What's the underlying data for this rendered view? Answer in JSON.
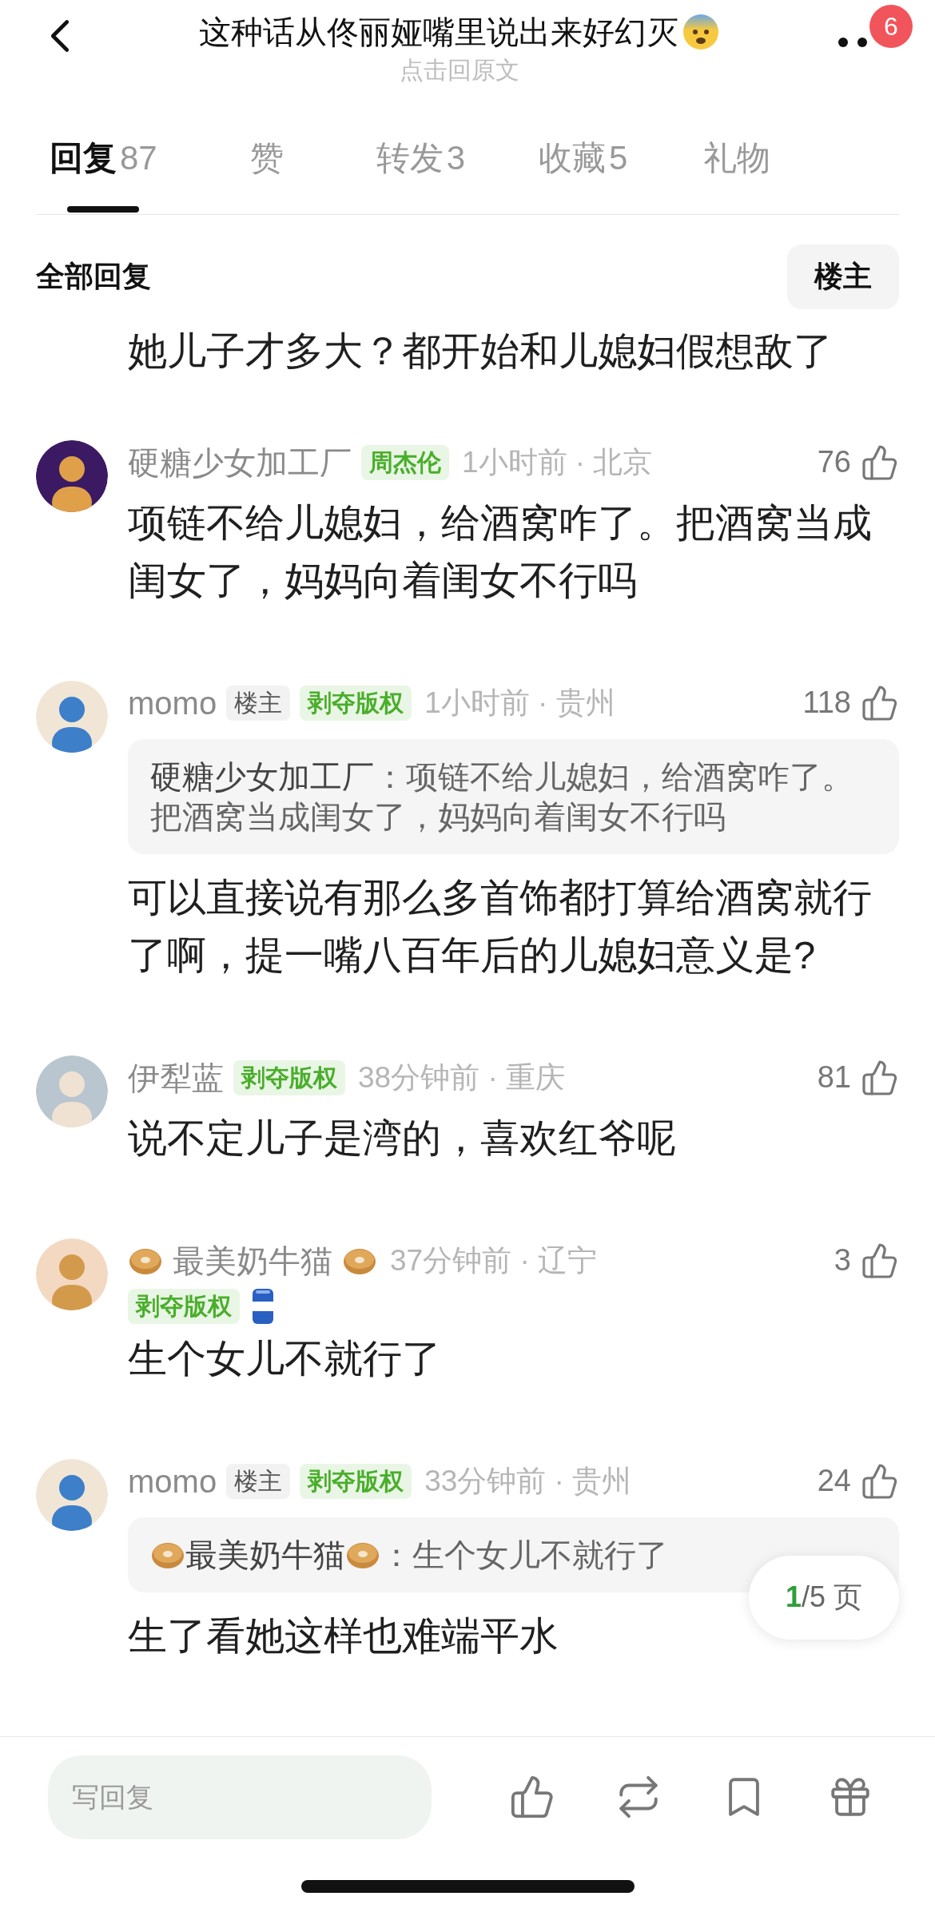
{
  "header": {
    "title": "这种话从佟丽娅嘴里说出来好幻灭",
    "subtitle": "点击回原文",
    "notification_count": "6"
  },
  "tabs": [
    {
      "label": "回复",
      "count": "87",
      "selected": true
    },
    {
      "label": "赞",
      "selected": false
    },
    {
      "label": "转发",
      "count": "3",
      "selected": false
    },
    {
      "label": "收藏",
      "count": "5",
      "selected": false
    },
    {
      "label": "礼物",
      "selected": false
    }
  ],
  "filter": {
    "label": "全部回复",
    "button": "楼主"
  },
  "partial_comment": {
    "text": "她儿子才多大？都开始和儿媳妇假想敌了"
  },
  "comments": [
    {
      "name": "硬糖少女加工厂",
      "name_bagels": false,
      "badges": [
        {
          "kind": "honor",
          "label": "周杰伦"
        }
      ],
      "badges_below": false,
      "time": "1小时前 · 北京",
      "likes": "76",
      "text": "项链不给儿媳妇，给酒窝咋了。把酒窝当成闺女了，妈妈向着闺女不行吗"
    },
    {
      "name": "momo",
      "name_bagels": false,
      "badges": [
        {
          "kind": "owner",
          "label": "楼主"
        },
        {
          "kind": "honor",
          "label": "剥夺版权"
        }
      ],
      "badges_below": false,
      "time": "1小时前 · 贵州",
      "likes": "118",
      "quote": {
        "author": "硬糖少女加工厂",
        "author_bagels": false,
        "lines": [
          "：项链不给儿媳妇，给酒窝咋了。",
          "把酒窝当成闺女了，妈妈向着闺女不行吗"
        ]
      },
      "text": "可以直接说有那么多首饰都打算给酒窝就行了啊，提一嘴八百年后的儿媳妇意义是?"
    },
    {
      "name": "伊犁蓝",
      "name_bagels": false,
      "badges": [
        {
          "kind": "honor",
          "label": "剥夺版权"
        }
      ],
      "badges_below": false,
      "time": "38分钟前 · 重庆",
      "likes": "81",
      "text": "说不定儿子是湾的，喜欢红爷呢"
    },
    {
      "name": "最美奶牛猫",
      "name_bagels": true,
      "badges": [
        {
          "kind": "honor",
          "label": "剥夺版权"
        },
        {
          "kind": "medal"
        }
      ],
      "badges_below": true,
      "time": "37分钟前 · 辽宁",
      "likes": "3",
      "text": "生个女儿不就行了"
    },
    {
      "name": "momo",
      "name_bagels": false,
      "badges": [
        {
          "kind": "owner",
          "label": "楼主"
        },
        {
          "kind": "honor",
          "label": "剥夺版权"
        }
      ],
      "badges_below": false,
      "time": "33分钟前 · 贵州",
      "likes": "24",
      "quote": {
        "author": "最美奶牛猫",
        "author_bagels": true,
        "lines": [
          "：生个女儿不就行了"
        ]
      },
      "text": "生了看她这样也难端平水"
    }
  ],
  "pager": {
    "current": "1",
    "total": "/5 页"
  },
  "reply_bar": {
    "placeholder": "写回复"
  }
}
